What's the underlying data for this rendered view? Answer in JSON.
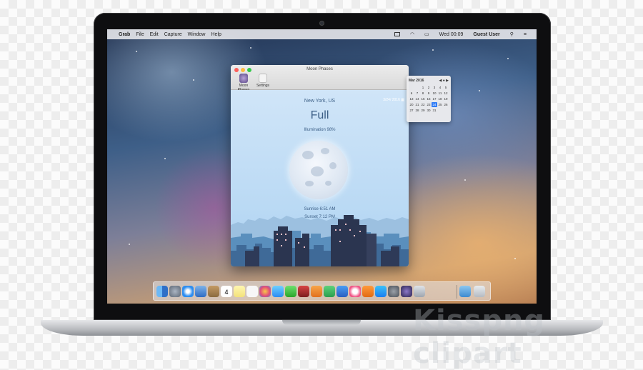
{
  "menubar": {
    "app": "Grab",
    "menus": [
      "File",
      "Edit",
      "Capture",
      "Window",
      "Help"
    ],
    "clock": "Wed 00:09",
    "user": "Guest User"
  },
  "window": {
    "title": "Moon Phases",
    "toolbar": [
      "Moon Phases",
      "Settings"
    ]
  },
  "moon": {
    "location": "New York, US",
    "date": "3/24/ 2016",
    "phase": "Full",
    "illumination": "Illumination 98%",
    "sunrise": "Sunrise 6:51 AM",
    "sunset": "Sunset 7:12 PM"
  },
  "calendar": {
    "month": "Mar 2016",
    "nav": "◀ ● ▶",
    "rows": [
      [
        "",
        "",
        "1",
        "2",
        "3",
        "4",
        "5"
      ],
      [
        "6",
        "7",
        "8",
        "9",
        "10",
        "11",
        "12"
      ],
      [
        "13",
        "14",
        "15",
        "16",
        "17",
        "18",
        "19"
      ],
      [
        "20",
        "21",
        "22",
        "23",
        "24",
        "25",
        "26"
      ],
      [
        "27",
        "28",
        "29",
        "30",
        "31",
        "",
        ""
      ]
    ],
    "selected": "24"
  },
  "dock": {
    "calendar_day": "4",
    "icons": [
      "finder-icon",
      "launchpad-icon",
      "safari-icon",
      "mail-icon",
      "contacts-icon",
      "calendar-icon",
      "notes-icon",
      "reminders-icon",
      "photos-icon",
      "messages-icon",
      "facetime-icon",
      "photo-booth-icon",
      "pages-icon",
      "numbers-icon",
      "keynote-icon",
      "itunes-icon",
      "ibooks-icon",
      "app-store-icon",
      "system-preferences-icon",
      "moon-phases-icon",
      "grab-icon",
      "downloads-icon",
      "trash-icon"
    ]
  },
  "watermark": "Kisspng clipart"
}
